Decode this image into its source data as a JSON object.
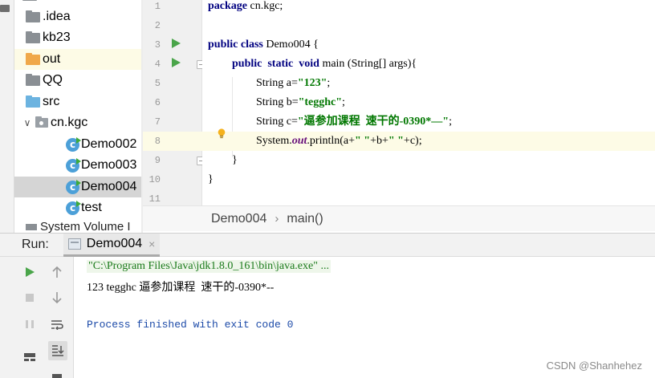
{
  "project_tree": {
    "items": [
      {
        "label": ".idea",
        "icon": "folder-icon"
      },
      {
        "label": "kb23",
        "icon": "folder-icon"
      },
      {
        "label": "out",
        "icon": "folder-icon"
      },
      {
        "label": "QQ",
        "icon": "folder-icon"
      },
      {
        "label": "src",
        "icon": "folder-icon"
      },
      {
        "label": "cn.kgc",
        "icon": "package-icon"
      },
      {
        "label": "Demo002",
        "icon": "class-icon"
      },
      {
        "label": "Demo003",
        "icon": "class-icon"
      },
      {
        "label": "Demo004",
        "icon": "class-icon"
      },
      {
        "label": "test",
        "icon": "class-icon"
      }
    ],
    "partial_bottom": "System Volume I"
  },
  "editor": {
    "line_numbers": [
      "1",
      "2",
      "3",
      "4",
      "5",
      "6",
      "7",
      "8",
      "9",
      "10",
      "11"
    ],
    "code": {
      "l1_kw": "package",
      "l1_rest": " cn.kgc;",
      "l3_kw1": "public",
      "l3_kw2": "class",
      "l3_rest": " Demo004 {",
      "l4_kw1": "public",
      "l4_kw2": "static",
      "l4_kw3": "void",
      "l4_rest": " main (String[] args){",
      "l5_pre": "String a=",
      "l5_str": "\"123\"",
      "l5_post": ";",
      "l6_pre": "String b=",
      "l6_str": "\"tegghc\"",
      "l6_post": ";",
      "l7_pre": "String c=",
      "l7_str": "\"逼参加课程  速干的-0390*—\"",
      "l7_post": ";",
      "l8_pre": "System.",
      "l8_field": "out",
      "l8_mid": ".println(a+",
      "l8_str1": "\" \"",
      "l8_mid2": "+b+",
      "l8_str2": "\" \"",
      "l8_post": "+c);",
      "l9": "}",
      "l10": "}"
    }
  },
  "breadcrumb": {
    "class": "Demo004",
    "method": "main()"
  },
  "run_panel": {
    "label": "Run:",
    "tab_label": "Demo004",
    "tab_close": "×",
    "console": {
      "command": "\"C:\\Program Files\\Java\\jdk1.8.0_161\\bin\\java.exe\" ...",
      "output": "123 tegghc 逼参加课程  速干的-0390*--",
      "exit": "Process finished with exit code 0"
    }
  },
  "watermark": "CSDN @Shanhehez",
  "colors": {
    "keyword": "#000080",
    "string": "#007700",
    "run_green": "#4aa54a",
    "exit_blue": "#1c4aa8"
  }
}
